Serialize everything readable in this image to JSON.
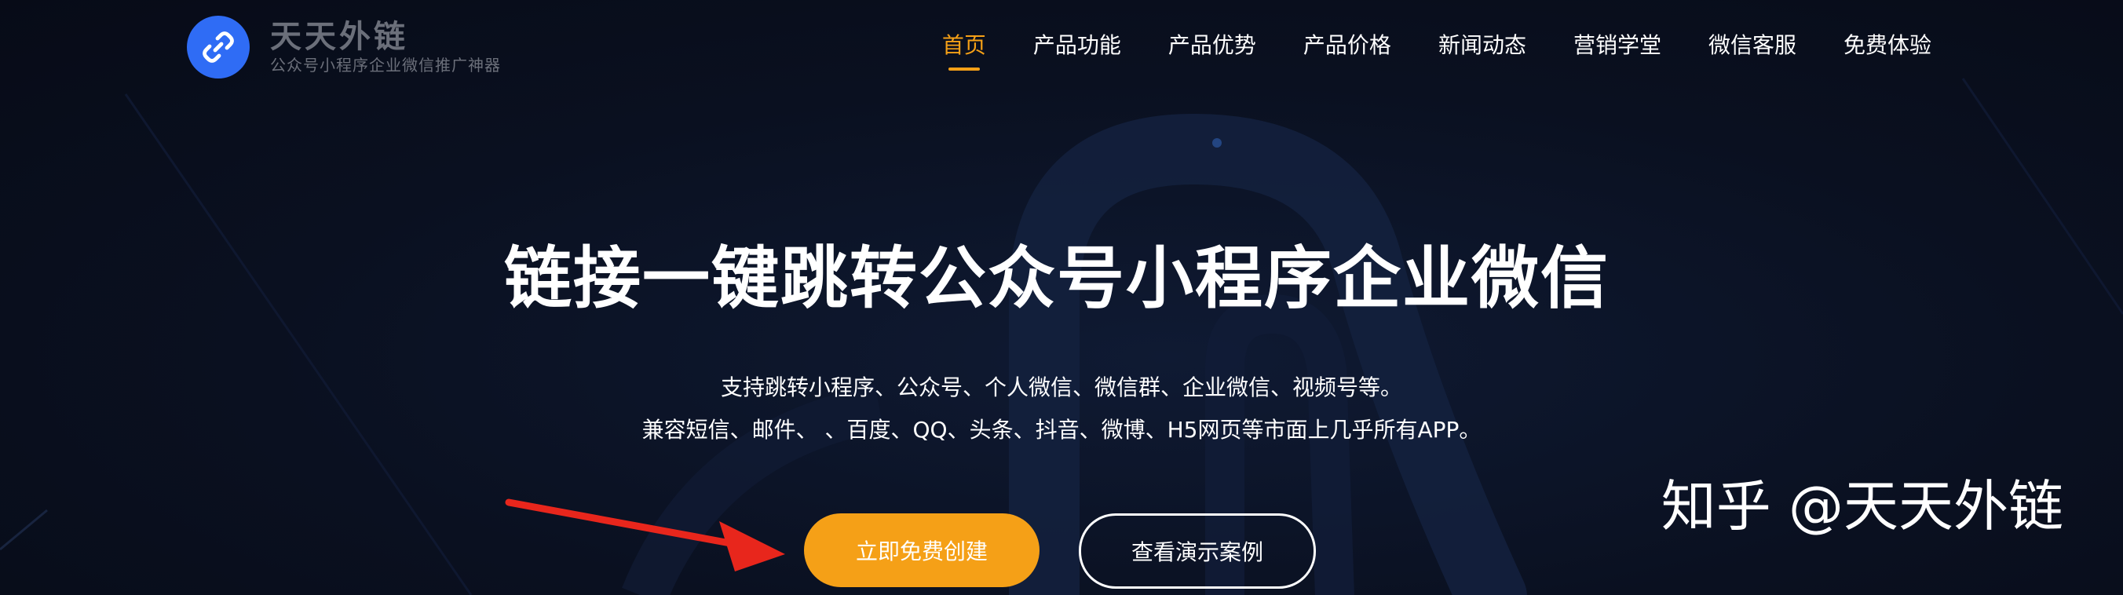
{
  "logo": {
    "title": "天天外链",
    "subtitle": "公众号小程序企业微信推广神器",
    "icon": "link-icon",
    "badge_color": "#2f6cf5"
  },
  "nav": {
    "items": [
      {
        "label": "首页",
        "active": true
      },
      {
        "label": "产品功能"
      },
      {
        "label": "产品优势"
      },
      {
        "label": "产品价格"
      },
      {
        "label": "新闻动态"
      },
      {
        "label": "营销学堂"
      },
      {
        "label": "微信客服"
      },
      {
        "label": "免费体验"
      }
    ],
    "active_color": "#f5a017"
  },
  "hero": {
    "title": "链接一键跳转公众号小程序企业微信",
    "line1": "支持跳转小程序、公众号、个人微信、微信群、企业微信、视频号等。",
    "line2": "兼容短信、邮件、 、百度、QQ、头条、抖音、微博、H5网页等市面上几乎所有APP。"
  },
  "buttons": {
    "primary": "立即免费创建",
    "secondary": "查看演示案例",
    "primary_color": "#f5a017"
  },
  "watermark": "知乎 @天天外链",
  "annotation": {
    "icon": "red-arrow-icon",
    "color": "#e8261c"
  }
}
